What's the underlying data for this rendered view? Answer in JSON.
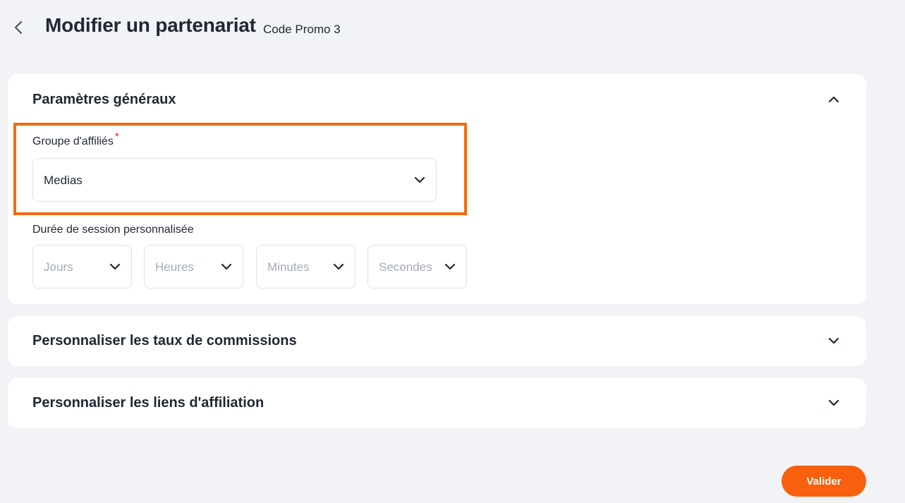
{
  "header": {
    "title": "Modifier un partenariat",
    "subtitle": "Code Promo 3",
    "back_icon": "chevron-left-icon"
  },
  "sections": {
    "general": {
      "title": "Paramètres généraux",
      "expanded": true,
      "toggle_icon": "chevron-up-icon",
      "affiliate_group": {
        "label": "Groupe d'affiliés",
        "required_marker": "*",
        "value": "Medias"
      },
      "session_duration": {
        "label": "Durée de session personnalisée",
        "fields": {
          "days": "Jours",
          "hours": "Heures",
          "minutes": "Minutes",
          "seconds": "Secondes"
        }
      }
    },
    "commissions": {
      "title": "Personnaliser les taux de commissions",
      "expanded": false,
      "toggle_icon": "chevron-down-icon"
    },
    "links": {
      "title": "Personnaliser les liens d'affiliation",
      "expanded": false,
      "toggle_icon": "chevron-down-icon"
    }
  },
  "actions": {
    "submit_label": "Valider"
  },
  "colors": {
    "accent": "#f8600d",
    "highlight": "#f26a10",
    "required": "#e52b2b",
    "background": "#f1f3f7",
    "text": "#1f2733",
    "placeholder": "#a4abb5"
  }
}
